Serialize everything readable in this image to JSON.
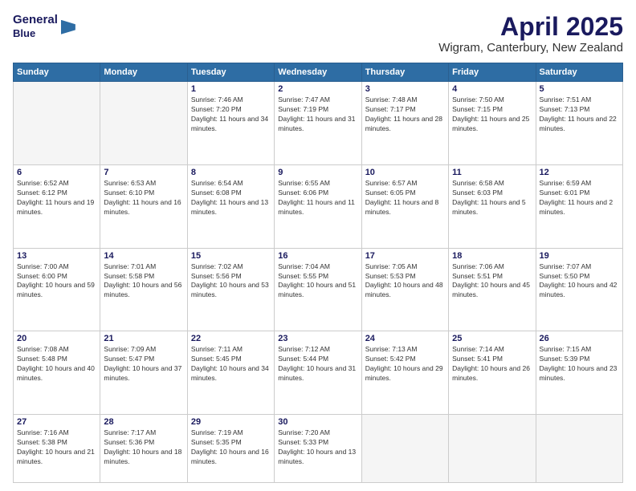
{
  "header": {
    "logo_line1": "General",
    "logo_line2": "Blue",
    "month": "April 2025",
    "location": "Wigram, Canterbury, New Zealand"
  },
  "days_of_week": [
    "Sunday",
    "Monday",
    "Tuesday",
    "Wednesday",
    "Thursday",
    "Friday",
    "Saturday"
  ],
  "weeks": [
    [
      {
        "num": "",
        "empty": true
      },
      {
        "num": "",
        "empty": true
      },
      {
        "num": "1",
        "sunrise": "7:46 AM",
        "sunset": "7:20 PM",
        "daylight": "11 hours and 34 minutes."
      },
      {
        "num": "2",
        "sunrise": "7:47 AM",
        "sunset": "7:19 PM",
        "daylight": "11 hours and 31 minutes."
      },
      {
        "num": "3",
        "sunrise": "7:48 AM",
        "sunset": "7:17 PM",
        "daylight": "11 hours and 28 minutes."
      },
      {
        "num": "4",
        "sunrise": "7:50 AM",
        "sunset": "7:15 PM",
        "daylight": "11 hours and 25 minutes."
      },
      {
        "num": "5",
        "sunrise": "7:51 AM",
        "sunset": "7:13 PM",
        "daylight": "11 hours and 22 minutes."
      }
    ],
    [
      {
        "num": "6",
        "sunrise": "6:52 AM",
        "sunset": "6:12 PM",
        "daylight": "11 hours and 19 minutes."
      },
      {
        "num": "7",
        "sunrise": "6:53 AM",
        "sunset": "6:10 PM",
        "daylight": "11 hours and 16 minutes."
      },
      {
        "num": "8",
        "sunrise": "6:54 AM",
        "sunset": "6:08 PM",
        "daylight": "11 hours and 13 minutes."
      },
      {
        "num": "9",
        "sunrise": "6:55 AM",
        "sunset": "6:06 PM",
        "daylight": "11 hours and 11 minutes."
      },
      {
        "num": "10",
        "sunrise": "6:57 AM",
        "sunset": "6:05 PM",
        "daylight": "11 hours and 8 minutes."
      },
      {
        "num": "11",
        "sunrise": "6:58 AM",
        "sunset": "6:03 PM",
        "daylight": "11 hours and 5 minutes."
      },
      {
        "num": "12",
        "sunrise": "6:59 AM",
        "sunset": "6:01 PM",
        "daylight": "11 hours and 2 minutes."
      }
    ],
    [
      {
        "num": "13",
        "sunrise": "7:00 AM",
        "sunset": "6:00 PM",
        "daylight": "10 hours and 59 minutes."
      },
      {
        "num": "14",
        "sunrise": "7:01 AM",
        "sunset": "5:58 PM",
        "daylight": "10 hours and 56 minutes."
      },
      {
        "num": "15",
        "sunrise": "7:02 AM",
        "sunset": "5:56 PM",
        "daylight": "10 hours and 53 minutes."
      },
      {
        "num": "16",
        "sunrise": "7:04 AM",
        "sunset": "5:55 PM",
        "daylight": "10 hours and 51 minutes."
      },
      {
        "num": "17",
        "sunrise": "7:05 AM",
        "sunset": "5:53 PM",
        "daylight": "10 hours and 48 minutes."
      },
      {
        "num": "18",
        "sunrise": "7:06 AM",
        "sunset": "5:51 PM",
        "daylight": "10 hours and 45 minutes."
      },
      {
        "num": "19",
        "sunrise": "7:07 AM",
        "sunset": "5:50 PM",
        "daylight": "10 hours and 42 minutes."
      }
    ],
    [
      {
        "num": "20",
        "sunrise": "7:08 AM",
        "sunset": "5:48 PM",
        "daylight": "10 hours and 40 minutes."
      },
      {
        "num": "21",
        "sunrise": "7:09 AM",
        "sunset": "5:47 PM",
        "daylight": "10 hours and 37 minutes."
      },
      {
        "num": "22",
        "sunrise": "7:11 AM",
        "sunset": "5:45 PM",
        "daylight": "10 hours and 34 minutes."
      },
      {
        "num": "23",
        "sunrise": "7:12 AM",
        "sunset": "5:44 PM",
        "daylight": "10 hours and 31 minutes."
      },
      {
        "num": "24",
        "sunrise": "7:13 AM",
        "sunset": "5:42 PM",
        "daylight": "10 hours and 29 minutes."
      },
      {
        "num": "25",
        "sunrise": "7:14 AM",
        "sunset": "5:41 PM",
        "daylight": "10 hours and 26 minutes."
      },
      {
        "num": "26",
        "sunrise": "7:15 AM",
        "sunset": "5:39 PM",
        "daylight": "10 hours and 23 minutes."
      }
    ],
    [
      {
        "num": "27",
        "sunrise": "7:16 AM",
        "sunset": "5:38 PM",
        "daylight": "10 hours and 21 minutes."
      },
      {
        "num": "28",
        "sunrise": "7:17 AM",
        "sunset": "5:36 PM",
        "daylight": "10 hours and 18 minutes."
      },
      {
        "num": "29",
        "sunrise": "7:19 AM",
        "sunset": "5:35 PM",
        "daylight": "10 hours and 16 minutes."
      },
      {
        "num": "30",
        "sunrise": "7:20 AM",
        "sunset": "5:33 PM",
        "daylight": "10 hours and 13 minutes."
      },
      {
        "num": "",
        "empty": true
      },
      {
        "num": "",
        "empty": true
      },
      {
        "num": "",
        "empty": true
      }
    ]
  ]
}
